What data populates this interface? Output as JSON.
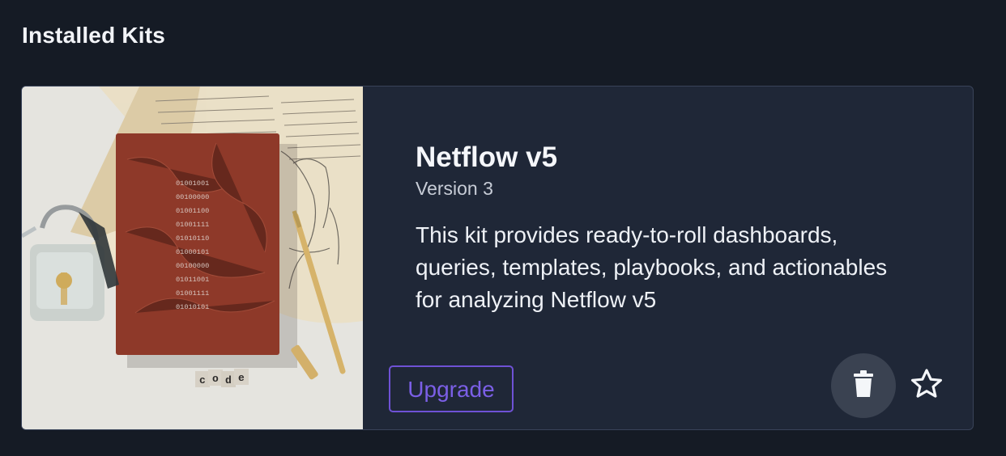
{
  "section": {
    "title": "Installed Kits"
  },
  "kit": {
    "title": "Netflow v5",
    "version": "Version 3",
    "description": "This kit provides ready-to-roll dashboards, queries, templates, playbooks, and actionables for analyzing Netflow v5",
    "image": {
      "binary_lines": [
        "01001001",
        "00100000",
        "01001100",
        "01001111",
        "01010110",
        "01000101",
        "00100000",
        "01011001",
        "01001111",
        "01010101"
      ],
      "block_letters": [
        "c",
        "o",
        "d",
        "e"
      ]
    },
    "actions": {
      "upgrade_label": "Upgrade",
      "delete_icon": "trash-icon",
      "favorite_icon": "star-outline-icon"
    }
  },
  "colors": {
    "page_background": "#151b25",
    "card_background": "#1f2737",
    "accent": "#6f52d6"
  }
}
